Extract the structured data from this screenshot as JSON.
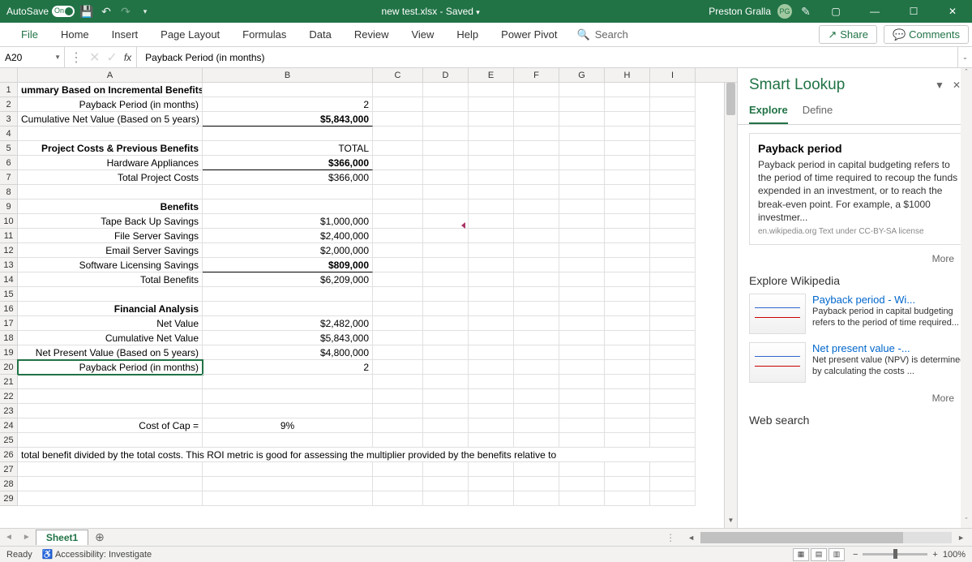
{
  "titlebar": {
    "autosave_label": "AutoSave",
    "toggle_state": "On",
    "filename": "new test.xlsx - Saved",
    "user": "Preston Gralla",
    "user_initials": "PG"
  },
  "ribbon": {
    "tabs": [
      "File",
      "Home",
      "Insert",
      "Page Layout",
      "Formulas",
      "Data",
      "Review",
      "View",
      "Help",
      "Power Pivot"
    ],
    "search_placeholder": "Search",
    "share": "Share",
    "comments": "Comments"
  },
  "formula_bar": {
    "cell_ref": "A20",
    "formula": "Payback Period (in months)"
  },
  "columns": [
    "A",
    "B",
    "C",
    "D",
    "E",
    "F",
    "G",
    "H",
    "I"
  ],
  "rows": [
    {
      "n": 1,
      "A": "ummary Based on Incremental Benefits",
      "Ab": true
    },
    {
      "n": 2,
      "A": "Payback Period (in months)",
      "Aa": "right",
      "B": "2",
      "Ba": "right"
    },
    {
      "n": 3,
      "A": "Cumulative Net Value  (Based on 5 years)",
      "Aa": "right",
      "B": "$5,843,000",
      "Ba": "right",
      "Bb": true
    },
    {
      "n": 4
    },
    {
      "n": 5,
      "A": "Project Costs & Previous Benefits",
      "Ab": true,
      "Aa": "right",
      "B": "TOTAL",
      "Ba": "right"
    },
    {
      "n": 6,
      "A": "Hardware Appliances",
      "Aa": "right",
      "B": "$366,000",
      "Ba": "right",
      "Bb": true
    },
    {
      "n": 7,
      "A": "Total Project Costs",
      "Aa": "right",
      "B": "$366,000",
      "Ba": "right"
    },
    {
      "n": 8
    },
    {
      "n": 9,
      "A": "Benefits",
      "Ab": true,
      "Aa": "right"
    },
    {
      "n": 10,
      "A": "Tape Back Up Savings",
      "Aa": "right",
      "B": "$1,000,000",
      "Ba": "right"
    },
    {
      "n": 11,
      "A": "File Server Savings",
      "Aa": "right",
      "B": "$2,400,000",
      "Ba": "right"
    },
    {
      "n": 12,
      "A": "Email Server Savings",
      "Aa": "right",
      "B": "$2,000,000",
      "Ba": "right"
    },
    {
      "n": 13,
      "A": "Software Licensing Savings",
      "Aa": "right",
      "B": "$809,000",
      "Ba": "right",
      "Bb": true
    },
    {
      "n": 14,
      "A": "Total Benefits",
      "Aa": "right",
      "B": "$6,209,000",
      "Ba": "right"
    },
    {
      "n": 15
    },
    {
      "n": 16,
      "A": "Financial Analysis",
      "Ab": true,
      "Aa": "right"
    },
    {
      "n": 17,
      "A": "Net Value",
      "Aa": "right",
      "B": "$2,482,000",
      "Ba": "right"
    },
    {
      "n": 18,
      "A": "Cumulative Net Value",
      "Aa": "right",
      "B": "$5,843,000",
      "Ba": "right"
    },
    {
      "n": 19,
      "A": "Net Present Value (Based on 5 years)",
      "Aa": "right",
      "B": "$4,800,000",
      "Ba": "right"
    },
    {
      "n": 20,
      "A": "Payback Period (in months)",
      "Aa": "right",
      "Asel": true,
      "B": "2",
      "Ba": "right"
    },
    {
      "n": 21
    },
    {
      "n": 22
    },
    {
      "n": 23
    },
    {
      "n": 24,
      "A": "Cost of Cap =",
      "Aa": "right",
      "B": "9%",
      "Ba": "center"
    },
    {
      "n": 25
    },
    {
      "n": 26,
      "A": "total benefit divided by the total costs.  This ROI metric is good for assessing the multiplier provided by the benefits relative to",
      "Aspan": true
    },
    {
      "n": 27
    },
    {
      "n": 28
    },
    {
      "n": 29
    }
  ],
  "pane": {
    "title": "Smart Lookup",
    "tabs": [
      "Explore",
      "Define"
    ],
    "card": {
      "title": "Payback period",
      "body": "Payback period in capital budgeting refers to the period of time required to recoup the funds expended in an investment, or to reach the break-even point. For example, a $1000 investmer...",
      "source": "en.wikipedia.org  Text under CC-BY-SA license"
    },
    "more": "More",
    "explore_h": "Explore Wikipedia",
    "items": [
      {
        "title": "Payback period - Wi...",
        "desc": "Payback period in capital budgeting refers to the period of time required..."
      },
      {
        "title": "Net present value -...",
        "desc": "Net present value (NPV) is determined by calculating the costs    ..."
      }
    ],
    "websearch": "Web search"
  },
  "sheet_tabs": {
    "active": "Sheet1"
  },
  "statusbar": {
    "ready": "Ready",
    "accessibility": "Accessibility: Investigate",
    "zoom": "100%"
  }
}
